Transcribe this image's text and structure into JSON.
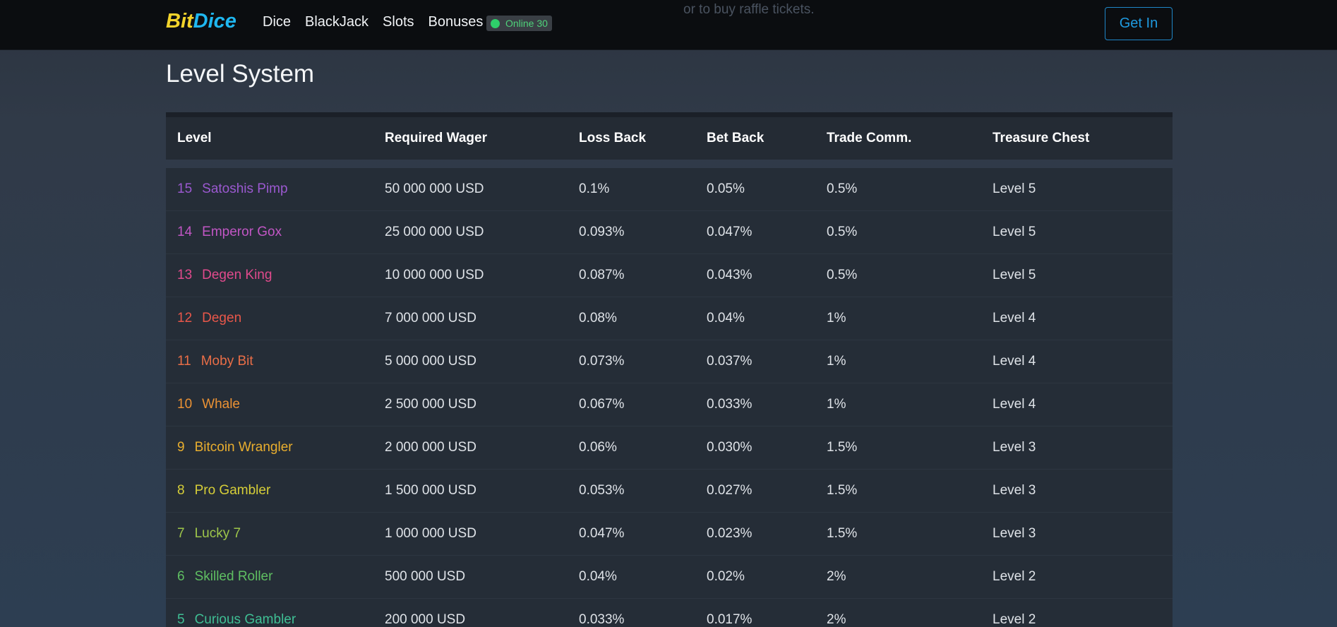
{
  "header": {
    "logo": {
      "part1": "Bit",
      "part2": "Dice"
    },
    "nav": [
      "Dice",
      "BlackJack",
      "Slots",
      "Bonuses"
    ],
    "online_label": "Online 30",
    "ghost_text": "or to buy raffle tickets.",
    "login_button": "Get In"
  },
  "page": {
    "title": "Level System"
  },
  "table": {
    "columns": [
      "Level",
      "Required Wager",
      "Loss Back",
      "Bet Back",
      "Trade Comm.",
      "Treasure Chest"
    ],
    "rows": [
      {
        "num": "15",
        "name": "Satoshis Pimp",
        "color": "#9b59d0",
        "wager": "50 000 000 USD",
        "loss": "0.1%",
        "bet": "0.05%",
        "trade": "0.5%",
        "chest": "Level 5"
      },
      {
        "num": "14",
        "name": "Emperor Gox",
        "color": "#c156c4",
        "wager": "25 000 000 USD",
        "loss": "0.093%",
        "bet": "0.047%",
        "trade": "0.5%",
        "chest": "Level 5"
      },
      {
        "num": "13",
        "name": "Degen King",
        "color": "#e04a8c",
        "wager": "10 000 000 USD",
        "loss": "0.087%",
        "bet": "0.043%",
        "trade": "0.5%",
        "chest": "Level 5"
      },
      {
        "num": "12",
        "name": "Degen",
        "color": "#e8574a",
        "wager": "7 000 000 USD",
        "loss": "0.08%",
        "bet": "0.04%",
        "trade": "1%",
        "chest": "Level 4"
      },
      {
        "num": "11",
        "name": "Moby Bit",
        "color": "#ea6e47",
        "wager": "5 000 000 USD",
        "loss": "0.073%",
        "bet": "0.037%",
        "trade": "1%",
        "chest": "Level 4"
      },
      {
        "num": "10",
        "name": "Whale",
        "color": "#eb9234",
        "wager": "2 500 000 USD",
        "loss": "0.067%",
        "bet": "0.033%",
        "trade": "1%",
        "chest": "Level 4"
      },
      {
        "num": "9",
        "name": "Bitcoin Wrangler",
        "color": "#e9ae2e",
        "wager": "2 000 000 USD",
        "loss": "0.06%",
        "bet": "0.030%",
        "trade": "1.5%",
        "chest": "Level 3"
      },
      {
        "num": "8",
        "name": "Pro Gambler",
        "color": "#d6ce38",
        "wager": "1 500 000 USD",
        "loss": "0.053%",
        "bet": "0.027%",
        "trade": "1.5%",
        "chest": "Level 3"
      },
      {
        "num": "7",
        "name": "Lucky 7",
        "color": "#9ec64a",
        "wager": "1 000 000 USD",
        "loss": "0.047%",
        "bet": "0.023%",
        "trade": "1.5%",
        "chest": "Level 3"
      },
      {
        "num": "6",
        "name": "Skilled Roller",
        "color": "#5fbf62",
        "wager": "500 000 USD",
        "loss": "0.04%",
        "bet": "0.02%",
        "trade": "2%",
        "chest": "Level 2"
      },
      {
        "num": "5",
        "name": "Curious Gambler",
        "color": "#3fbf94",
        "wager": "200 000 USD",
        "loss": "0.033%",
        "bet": "0.017%",
        "trade": "2%",
        "chest": "Level 2"
      }
    ]
  }
}
